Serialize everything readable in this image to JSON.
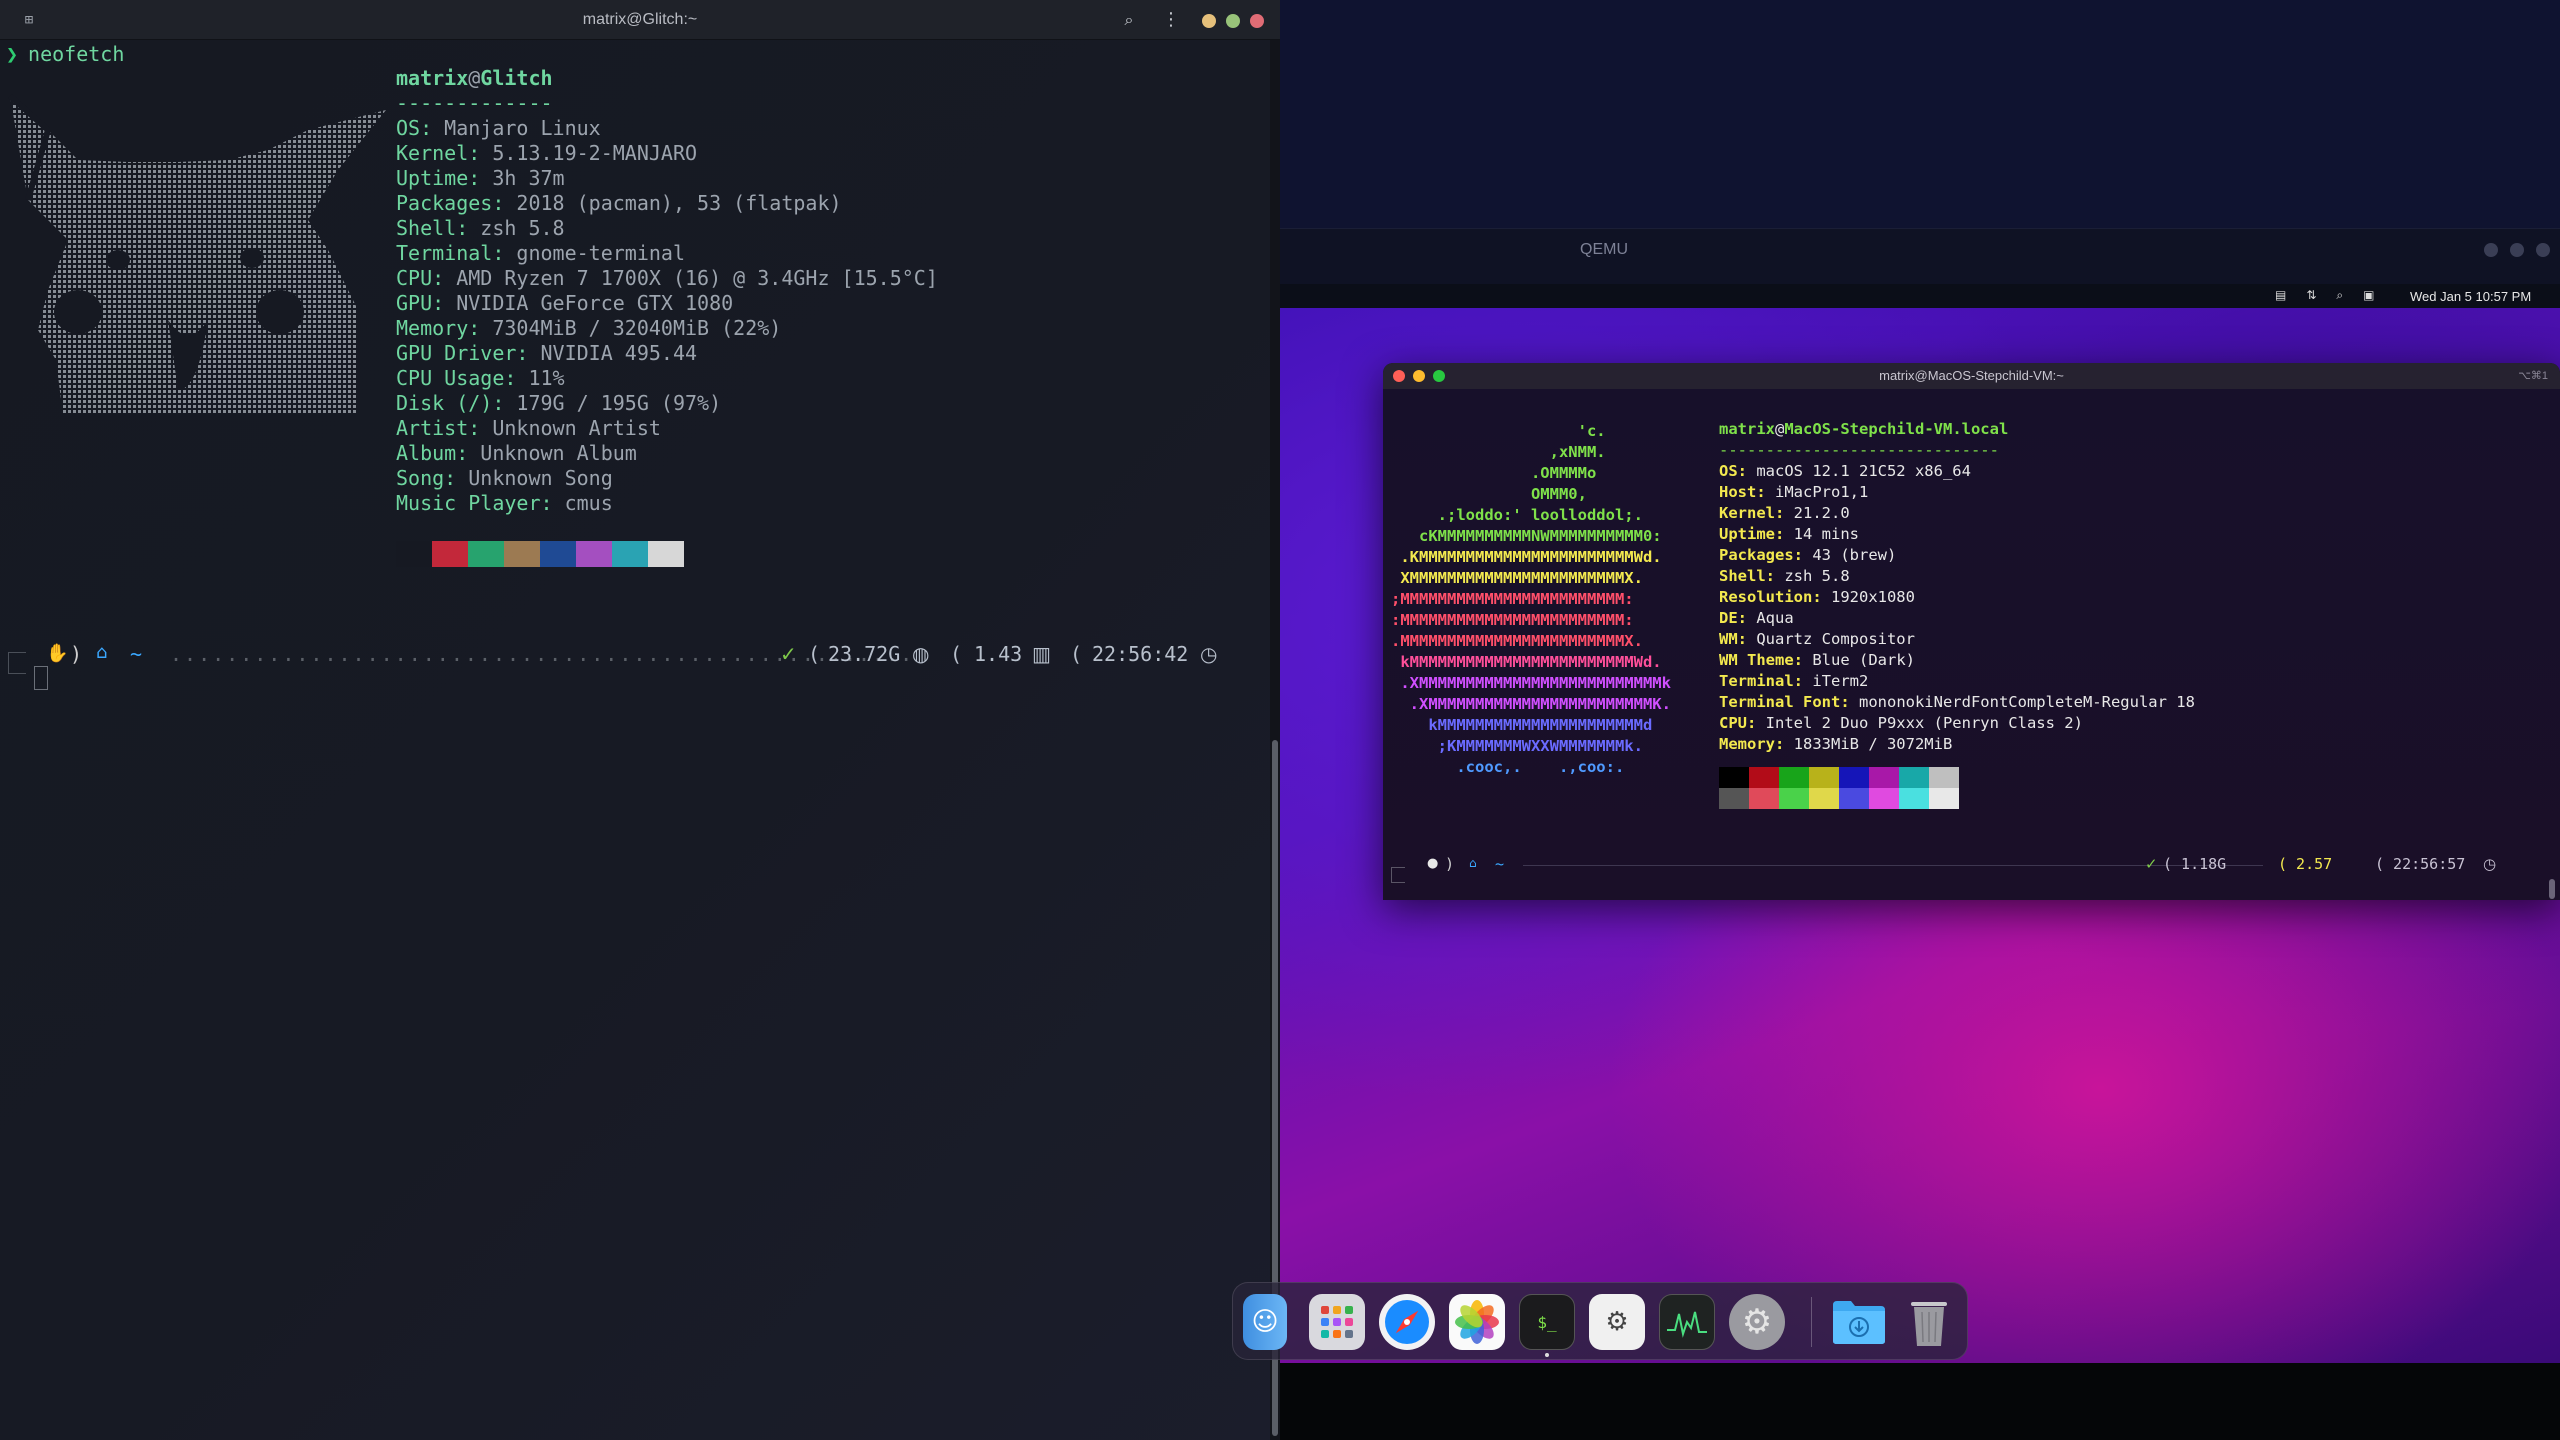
{
  "left_terminal": {
    "title": "matrix@Glitch:~",
    "command_prompt_symbol": "❯",
    "command": "neofetch",
    "user": "matrix",
    "at": "@",
    "host": "Glitch",
    "separator": "-------------",
    "info": [
      {
        "key": "OS:",
        "value": " Manjaro Linux"
      },
      {
        "key": "Kernel:",
        "value": " 5.13.19-2-MANJARO"
      },
      {
        "key": "Uptime:",
        "value": " 3h 37m"
      },
      {
        "key": "Packages:",
        "value": " 2018 (pacman), 53 (flatpak)"
      },
      {
        "key": "Shell:",
        "value": " zsh 5.8"
      },
      {
        "key": "Terminal:",
        "value": " gnome-terminal"
      },
      {
        "key": "CPU:",
        "value": " AMD Ryzen 7 1700X (16) @ 3.4GHz [15.5°C]"
      },
      {
        "key": "GPU:",
        "value": " NVIDIA GeForce GTX 1080"
      },
      {
        "key": "Memory:",
        "value": " 7304MiB / 32040MiB (22%)"
      },
      {
        "key": "GPU Driver:",
        "value": " NVIDIA 495.44"
      },
      {
        "key": "CPU Usage:",
        "value": " 11%"
      },
      {
        "key": "Disk (/):",
        "value": " 179G / 195G (97%)"
      },
      {
        "key": "Artist:",
        "value": " Unknown Artist"
      },
      {
        "key": "Album:",
        "value": " Unknown Album"
      },
      {
        "key": "Song:",
        "value": " Unknown Song"
      },
      {
        "key": "Music Player:",
        "value": " cmus"
      }
    ],
    "palette": [
      "#161922",
      "#c3283a",
      "#27a36e",
      "#9c7a52",
      "#1f4a94",
      "#a44fc0",
      "#2aa3b3",
      "#d7d7d7"
    ],
    "prompt": {
      "paren": ")",
      "tilde": "~",
      "dots": ".....................................................",
      "open_paren_1": "(",
      "memory": "23.72G",
      "open_paren_2": "(",
      "load": "1.43",
      "open_paren_3": "(",
      "time": "22:56:42"
    }
  },
  "qemu": {
    "title": "QEMU"
  },
  "mac_menubar": {
    "clock": "Wed Jan 5  10:57 PM"
  },
  "iterm": {
    "title": "matrix@MacOS-Stepchild-VM:~",
    "shortcut": "⌥⌘1",
    "apple_art": [
      {
        "text": "                    'c.",
        "color": "#7fe14a"
      },
      {
        "text": "                 ,xNMM.",
        "color": "#7fe14a"
      },
      {
        "text": "               .OMMMMo",
        "color": "#7fe14a"
      },
      {
        "text": "               OMMM0,",
        "color": "#7fe14a"
      },
      {
        "text": "     .;loddo:' loolloddol;.",
        "color": "#7fe14a"
      },
      {
        "text": "   cKMMMMMMMMMMNWMMMMMMMMMM0:",
        "color": "#7fe14a"
      },
      {
        "text": " .KMMMMMMMMMMMMMMMMMMMMMMMWd.",
        "color": "#f3e94f"
      },
      {
        "text": " XMMMMMMMMMMMMMMMMMMMMMMMX.",
        "color": "#f3e94f"
      },
      {
        "text": ";MMMMMMMMMMMMMMMMMMMMMMMM:",
        "color": "#ff4f6a"
      },
      {
        "text": ":MMMMMMMMMMMMMMMMMMMMMMMM:",
        "color": "#ff4f6a"
      },
      {
        "text": ".MMMMMMMMMMMMMMMMMMMMMMMMX.",
        "color": "#ff4f6a"
      },
      {
        "text": " kMMMMMMMMMMMMMMMMMMMMMMMMWd.",
        "color": "#ff4f9a"
      },
      {
        "text": " .XMMMMMMMMMMMMMMMMMMMMMMMMMMk",
        "color": "#d04fff"
      },
      {
        "text": "  .XMMMMMMMMMMMMMMMMMMMMMMMMK.",
        "color": "#d04fff"
      },
      {
        "text": "    kMMMMMMMMMMMMMMMMMMMMMMd",
        "color": "#6b6bff"
      },
      {
        "text": "     ;KMMMMMMMWXXWMMMMMMMk.",
        "color": "#6b6bff"
      },
      {
        "text": "       .cooc,.    .,coo:.",
        "color": "#4f9aff"
      }
    ],
    "user": "matrix",
    "at": "@",
    "host": "MacOS-Stepchild-VM.local",
    "separator": "------------------------------",
    "info": [
      {
        "key": "OS:",
        "value": " macOS 12.1 21C52 x86_64"
      },
      {
        "key": "Host:",
        "value": " iMacPro1,1"
      },
      {
        "key": "Kernel:",
        "value": " 21.2.0"
      },
      {
        "key": "Uptime:",
        "value": " 14 mins"
      },
      {
        "key": "Packages:",
        "value": " 43 (brew)"
      },
      {
        "key": "Shell:",
        "value": " zsh 5.8"
      },
      {
        "key": "Resolution:",
        "value": " 1920x1080"
      },
      {
        "key": "DE:",
        "value": " Aqua"
      },
      {
        "key": "WM:",
        "value": " Quartz Compositor"
      },
      {
        "key": "WM Theme:",
        "value": " Blue (Dark)"
      },
      {
        "key": "Terminal:",
        "value": " iTerm2"
      },
      {
        "key": "Terminal Font:",
        "value": " mononokiNerdFontCompleteM-Regular 18"
      },
      {
        "key": "CPU:",
        "value": " Intel 2 Duo P9xxx (Penryn Class 2)"
      },
      {
        "key": "Memory:",
        "value": " 1833MiB / 3072MiB"
      }
    ],
    "palette_top": [
      "#000000",
      "#b20c18",
      "#18a41a",
      "#b8b21a",
      "#1515b8",
      "#a818a8",
      "#18a8a8",
      "#bfbfbf"
    ],
    "palette_bottom": [
      "#555555",
      "#e04a5a",
      "#4ad24a",
      "#e0d84a",
      "#4a4ae0",
      "#e04ae0",
      "#4ae0e0",
      "#e8e8e8"
    ],
    "prompt": {
      "paren": ")",
      "tilde": "~",
      "memory": "( 1.18G",
      "load": "( 2.57",
      "time": "( 22:56:57"
    }
  },
  "dock": {
    "items": [
      "finder-icon",
      "launchpad-icon",
      "safari-icon",
      "photos-icon",
      "terminal-icon",
      "script-editor-icon",
      "activity-monitor-icon",
      "system-preferences-icon",
      "downloads-folder-icon",
      "trash-icon"
    ]
  }
}
